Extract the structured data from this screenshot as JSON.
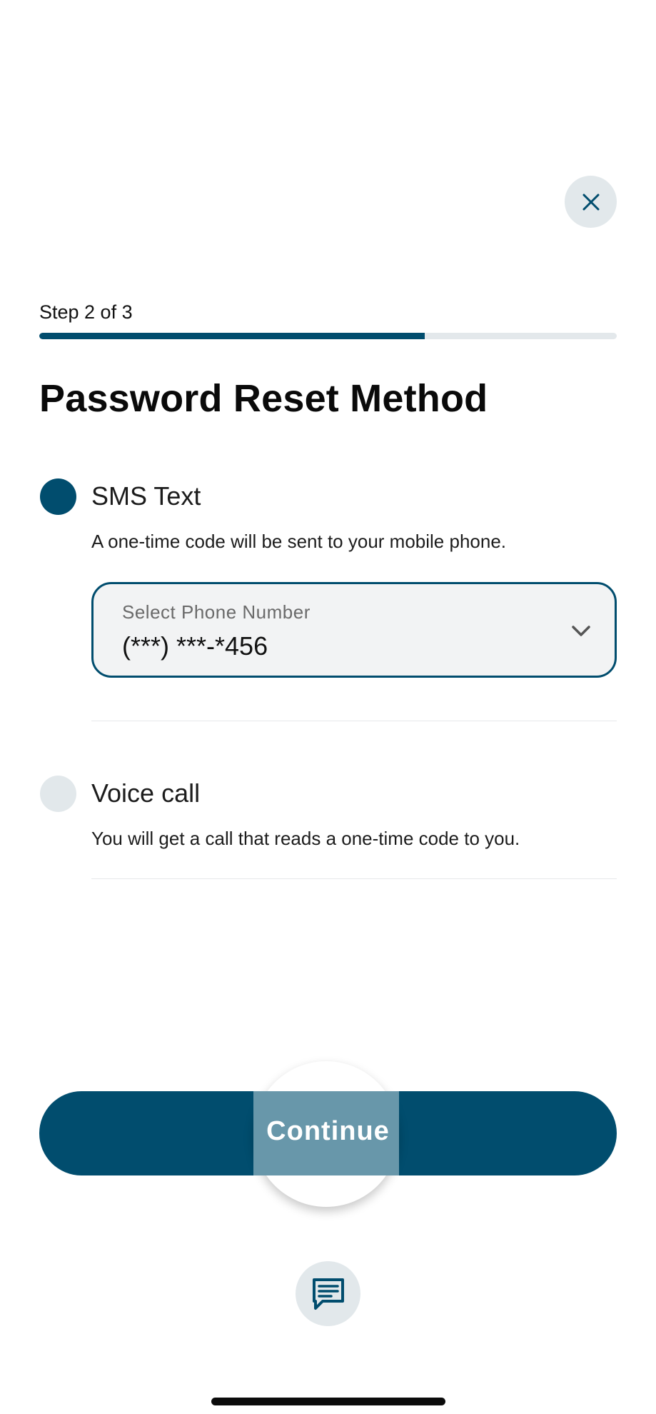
{
  "header": {
    "close_icon": "close-icon"
  },
  "stepper": {
    "label": "Step 2 of 3",
    "current": 2,
    "total": 3,
    "progress_fraction": 0.667
  },
  "title": "Password Reset Method",
  "options": [
    {
      "title": "SMS Text",
      "description": "A one-time code will be sent to your mobile phone.",
      "selected": true
    },
    {
      "title": "Voice call",
      "description": "You will get a call that reads a one-time code to you.",
      "selected": false
    }
  ],
  "phone_select": {
    "label": "Select Phone Number",
    "value": "(***) ***-*456",
    "icon": "chevron-down-icon"
  },
  "continue_button": {
    "label": "Continue"
  },
  "chat": {
    "icon": "chat-icon"
  },
  "colors": {
    "primary": "#014d6e",
    "secondary_bg": "#e2e8eb",
    "select_bg": "#f2f3f4"
  }
}
